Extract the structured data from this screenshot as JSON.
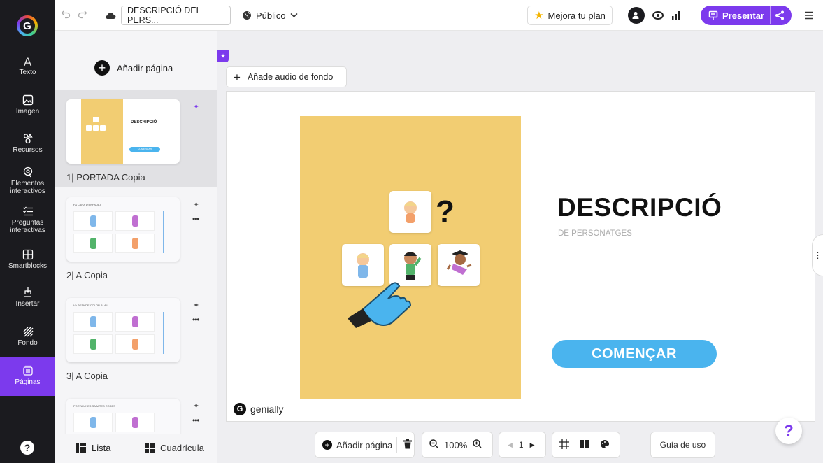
{
  "topbar": {
    "title": "DESCRIPCIÓ DEL PERS...",
    "visibility": "Público",
    "upgrade": "Mejora tu plan",
    "present": "Presentar"
  },
  "sidebar": {
    "items": [
      {
        "label": "Texto"
      },
      {
        "label": "Imagen"
      },
      {
        "label": "Recursos"
      },
      {
        "label": "Elementos interactivos"
      },
      {
        "label": "Preguntas interactivas"
      },
      {
        "label": "Smartblocks"
      },
      {
        "label": "Insertar"
      },
      {
        "label": "Fondo"
      },
      {
        "label": "Páginas"
      }
    ]
  },
  "pages_panel": {
    "add_page": "Añadir página",
    "pages": [
      {
        "label": "1| PORTADA Copia",
        "thumb_title": "DESCRIPCIÓ",
        "thumb_button": "COMENÇAR"
      },
      {
        "label": "2| A Copia",
        "thumb_title": "FA CARA D'ENFADAT"
      },
      {
        "label": "3| A Copia",
        "thumb_title": "VA TOTA DE COLOR BLAU"
      },
      {
        "label": "",
        "thumb_title": "PORTA UNES SABATES ROSES"
      }
    ],
    "view_list": "Lista",
    "view_grid": "Cuadrícula"
  },
  "canvas": {
    "add_audio": "Añade audio de fondo",
    "slide_title": "DESCRIPCIÓ",
    "slide_subtitle": "DE PERSONATGES",
    "start_button": "COMENÇAR",
    "brand": "genially",
    "question_mark": "?"
  },
  "bottom": {
    "add_page": "Añadir página",
    "zoom": "100%",
    "page_number": "1",
    "guide": "Guía de uso"
  },
  "colors": {
    "accent": "#7c3aed",
    "slide_yellow": "#f2cd72",
    "start_button": "#4ab4ee",
    "sidebar_bg": "#1b1b1f"
  }
}
